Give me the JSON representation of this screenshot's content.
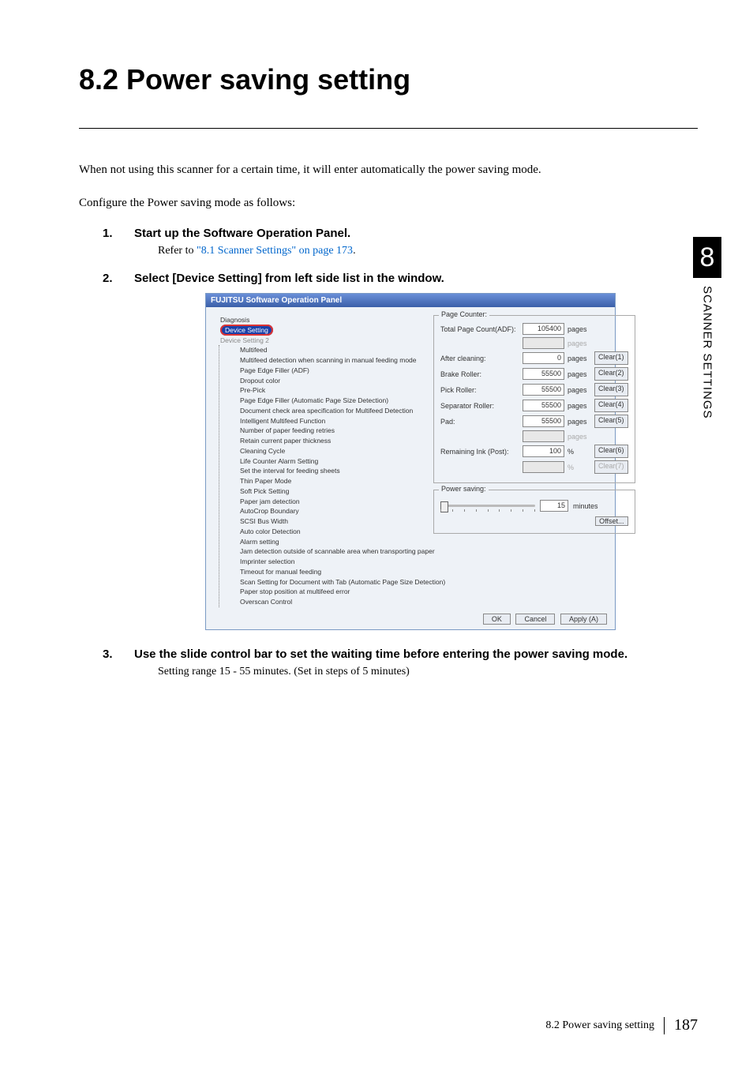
{
  "heading": "8.2  Power saving setting",
  "intro1": "When not using this scanner for a certain time, it will enter automatically the power saving mode.",
  "intro2": "Configure the Power saving mode as follows:",
  "steps": {
    "s1_num": "1.",
    "s1": "Start up the Software Operation Panel.",
    "s1_sub_a": "Refer to ",
    "s1_sub_link": "\"8.1 Scanner Settings\" on page 173",
    "s1_sub_b": ".",
    "s2_num": "2.",
    "s2": "Select [Device Setting] from left side list in the window.",
    "s3_num": "3.",
    "s3": "Use the slide control bar to set the waiting time before entering the power saving mode.",
    "s3_sub": "Setting range 15 - 55 minutes. (Set in steps of 5 minutes)"
  },
  "app": {
    "title": "FUJITSU Software Operation Panel",
    "tree": {
      "root": "Diagnosis",
      "sel": "Device Setting",
      "group": "Device Setting 2",
      "items": [
        "Multifeed",
        "Multifeed detection when scanning in manual feeding mode",
        "Page Edge Filler (ADF)",
        "Dropout color",
        "Pre-Pick",
        "Page Edge Filler (Automatic Page Size Detection)",
        "Document check area specification for Multifeed Detection",
        "Intelligent Multifeed Function",
        "Number of paper feeding retries",
        "Retain current paper thickness",
        "Cleaning Cycle",
        "Life Counter Alarm Setting",
        "Set the interval for feeding sheets",
        "Thin Paper Mode",
        "Soft Pick Setting",
        "Paper jam detection",
        "AutoCrop Boundary",
        "SCSI Bus Width",
        "Auto color Detection",
        "Alarm setting",
        "Jam detection outside of scannable area when transporting paper",
        "Imprinter selection",
        "Timeout for manual feeding",
        "Scan Setting for Document with Tab (Automatic Page Size Detection)",
        "Paper stop position at multifeed error",
        "Overscan Control"
      ]
    },
    "page_counter_title": "Page Counter:",
    "rows": [
      {
        "label": "Total Page Count(ADF):",
        "val": "105400",
        "unit": "pages",
        "btn": "",
        "dis": false,
        "nobtn": true
      },
      {
        "label": "",
        "val": "",
        "unit": "pages",
        "btn": "",
        "dis": true,
        "nobtn": true
      },
      {
        "label": "After cleaning:",
        "val": "0",
        "unit": "pages",
        "btn": "Clear(1)",
        "dis": false
      },
      {
        "label": "Brake Roller:",
        "val": "55500",
        "unit": "pages",
        "btn": "Clear(2)",
        "dis": false
      },
      {
        "label": "Pick Roller:",
        "val": "55500",
        "unit": "pages",
        "btn": "Clear(3)",
        "dis": false
      },
      {
        "label": "Separator Roller:",
        "val": "55500",
        "unit": "pages",
        "btn": "Clear(4)",
        "dis": false
      },
      {
        "label": "Pad:",
        "val": "55500",
        "unit": "pages",
        "btn": "Clear(5)",
        "dis": false
      },
      {
        "label": "",
        "val": "",
        "unit": "pages",
        "btn": "",
        "dis": true,
        "nobtn": true
      },
      {
        "label": "Remaining Ink (Post):",
        "val": "100",
        "unit": "%",
        "btn": "Clear(6)",
        "dis": false
      },
      {
        "label": "",
        "val": "",
        "unit": "%",
        "btn": "Clear(7)",
        "dis": true
      }
    ],
    "power_title": "Power saving:",
    "power_val": "15",
    "power_unit": "minutes",
    "offset_btn": "Offset...",
    "ok": "OK",
    "cancel": "Cancel",
    "apply": "Apply (A)"
  },
  "side": {
    "chap": "8",
    "label": "SCANNER SETTINGS"
  },
  "footer": {
    "section": "8.2 Power saving setting",
    "page": "187"
  }
}
